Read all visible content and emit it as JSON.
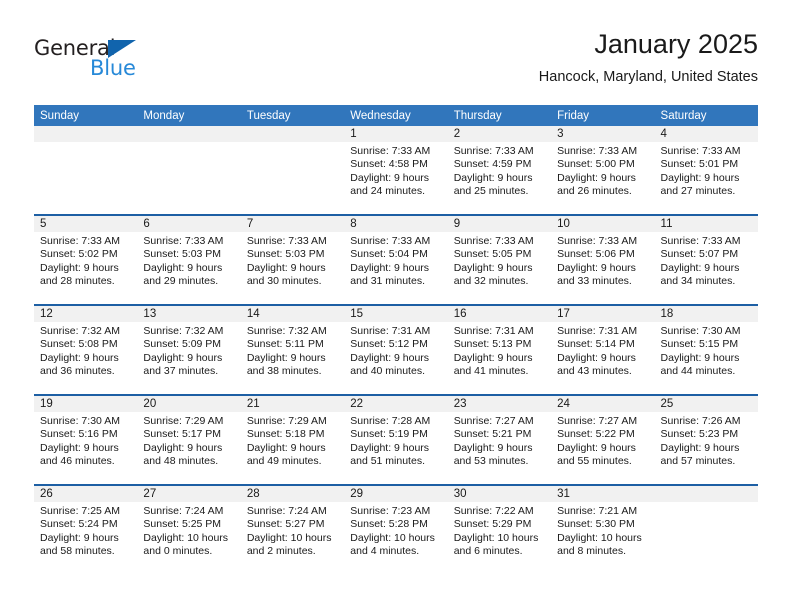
{
  "brand": {
    "name_part1": "General",
    "name_part2": "Blue",
    "color_dark": "#231f20",
    "color_blue": "#2789d8",
    "triangle_color": "#1164ad"
  },
  "header": {
    "title": "January 2025",
    "subtitle": "Hancock, Maryland, United States"
  },
  "theme": {
    "header_bar": "#3176bc",
    "row_divider": "#1d5fa4",
    "day_band": "#f1f1f1"
  },
  "weekdays": [
    "Sunday",
    "Monday",
    "Tuesday",
    "Wednesday",
    "Thursday",
    "Friday",
    "Saturday"
  ],
  "weeks": [
    [
      {
        "day": "",
        "sunrise": "",
        "sunset": "",
        "daylight1": "",
        "daylight2": ""
      },
      {
        "day": "",
        "sunrise": "",
        "sunset": "",
        "daylight1": "",
        "daylight2": ""
      },
      {
        "day": "",
        "sunrise": "",
        "sunset": "",
        "daylight1": "",
        "daylight2": ""
      },
      {
        "day": "1",
        "sunrise": "Sunrise: 7:33 AM",
        "sunset": "Sunset: 4:58 PM",
        "daylight1": "Daylight: 9 hours",
        "daylight2": "and 24 minutes."
      },
      {
        "day": "2",
        "sunrise": "Sunrise: 7:33 AM",
        "sunset": "Sunset: 4:59 PM",
        "daylight1": "Daylight: 9 hours",
        "daylight2": "and 25 minutes."
      },
      {
        "day": "3",
        "sunrise": "Sunrise: 7:33 AM",
        "sunset": "Sunset: 5:00 PM",
        "daylight1": "Daylight: 9 hours",
        "daylight2": "and 26 minutes."
      },
      {
        "day": "4",
        "sunrise": "Sunrise: 7:33 AM",
        "sunset": "Sunset: 5:01 PM",
        "daylight1": "Daylight: 9 hours",
        "daylight2": "and 27 minutes."
      }
    ],
    [
      {
        "day": "5",
        "sunrise": "Sunrise: 7:33 AM",
        "sunset": "Sunset: 5:02 PM",
        "daylight1": "Daylight: 9 hours",
        "daylight2": "and 28 minutes."
      },
      {
        "day": "6",
        "sunrise": "Sunrise: 7:33 AM",
        "sunset": "Sunset: 5:03 PM",
        "daylight1": "Daylight: 9 hours",
        "daylight2": "and 29 minutes."
      },
      {
        "day": "7",
        "sunrise": "Sunrise: 7:33 AM",
        "sunset": "Sunset: 5:03 PM",
        "daylight1": "Daylight: 9 hours",
        "daylight2": "and 30 minutes."
      },
      {
        "day": "8",
        "sunrise": "Sunrise: 7:33 AM",
        "sunset": "Sunset: 5:04 PM",
        "daylight1": "Daylight: 9 hours",
        "daylight2": "and 31 minutes."
      },
      {
        "day": "9",
        "sunrise": "Sunrise: 7:33 AM",
        "sunset": "Sunset: 5:05 PM",
        "daylight1": "Daylight: 9 hours",
        "daylight2": "and 32 minutes."
      },
      {
        "day": "10",
        "sunrise": "Sunrise: 7:33 AM",
        "sunset": "Sunset: 5:06 PM",
        "daylight1": "Daylight: 9 hours",
        "daylight2": "and 33 minutes."
      },
      {
        "day": "11",
        "sunrise": "Sunrise: 7:33 AM",
        "sunset": "Sunset: 5:07 PM",
        "daylight1": "Daylight: 9 hours",
        "daylight2": "and 34 minutes."
      }
    ],
    [
      {
        "day": "12",
        "sunrise": "Sunrise: 7:32 AM",
        "sunset": "Sunset: 5:08 PM",
        "daylight1": "Daylight: 9 hours",
        "daylight2": "and 36 minutes."
      },
      {
        "day": "13",
        "sunrise": "Sunrise: 7:32 AM",
        "sunset": "Sunset: 5:09 PM",
        "daylight1": "Daylight: 9 hours",
        "daylight2": "and 37 minutes."
      },
      {
        "day": "14",
        "sunrise": "Sunrise: 7:32 AM",
        "sunset": "Sunset: 5:11 PM",
        "daylight1": "Daylight: 9 hours",
        "daylight2": "and 38 minutes."
      },
      {
        "day": "15",
        "sunrise": "Sunrise: 7:31 AM",
        "sunset": "Sunset: 5:12 PM",
        "daylight1": "Daylight: 9 hours",
        "daylight2": "and 40 minutes."
      },
      {
        "day": "16",
        "sunrise": "Sunrise: 7:31 AM",
        "sunset": "Sunset: 5:13 PM",
        "daylight1": "Daylight: 9 hours",
        "daylight2": "and 41 minutes."
      },
      {
        "day": "17",
        "sunrise": "Sunrise: 7:31 AM",
        "sunset": "Sunset: 5:14 PM",
        "daylight1": "Daylight: 9 hours",
        "daylight2": "and 43 minutes."
      },
      {
        "day": "18",
        "sunrise": "Sunrise: 7:30 AM",
        "sunset": "Sunset: 5:15 PM",
        "daylight1": "Daylight: 9 hours",
        "daylight2": "and 44 minutes."
      }
    ],
    [
      {
        "day": "19",
        "sunrise": "Sunrise: 7:30 AM",
        "sunset": "Sunset: 5:16 PM",
        "daylight1": "Daylight: 9 hours",
        "daylight2": "and 46 minutes."
      },
      {
        "day": "20",
        "sunrise": "Sunrise: 7:29 AM",
        "sunset": "Sunset: 5:17 PM",
        "daylight1": "Daylight: 9 hours",
        "daylight2": "and 48 minutes."
      },
      {
        "day": "21",
        "sunrise": "Sunrise: 7:29 AM",
        "sunset": "Sunset: 5:18 PM",
        "daylight1": "Daylight: 9 hours",
        "daylight2": "and 49 minutes."
      },
      {
        "day": "22",
        "sunrise": "Sunrise: 7:28 AM",
        "sunset": "Sunset: 5:19 PM",
        "daylight1": "Daylight: 9 hours",
        "daylight2": "and 51 minutes."
      },
      {
        "day": "23",
        "sunrise": "Sunrise: 7:27 AM",
        "sunset": "Sunset: 5:21 PM",
        "daylight1": "Daylight: 9 hours",
        "daylight2": "and 53 minutes."
      },
      {
        "day": "24",
        "sunrise": "Sunrise: 7:27 AM",
        "sunset": "Sunset: 5:22 PM",
        "daylight1": "Daylight: 9 hours",
        "daylight2": "and 55 minutes."
      },
      {
        "day": "25",
        "sunrise": "Sunrise: 7:26 AM",
        "sunset": "Sunset: 5:23 PM",
        "daylight1": "Daylight: 9 hours",
        "daylight2": "and 57 minutes."
      }
    ],
    [
      {
        "day": "26",
        "sunrise": "Sunrise: 7:25 AM",
        "sunset": "Sunset: 5:24 PM",
        "daylight1": "Daylight: 9 hours",
        "daylight2": "and 58 minutes."
      },
      {
        "day": "27",
        "sunrise": "Sunrise: 7:24 AM",
        "sunset": "Sunset: 5:25 PM",
        "daylight1": "Daylight: 10 hours",
        "daylight2": "and 0 minutes."
      },
      {
        "day": "28",
        "sunrise": "Sunrise: 7:24 AM",
        "sunset": "Sunset: 5:27 PM",
        "daylight1": "Daylight: 10 hours",
        "daylight2": "and 2 minutes."
      },
      {
        "day": "29",
        "sunrise": "Sunrise: 7:23 AM",
        "sunset": "Sunset: 5:28 PM",
        "daylight1": "Daylight: 10 hours",
        "daylight2": "and 4 minutes."
      },
      {
        "day": "30",
        "sunrise": "Sunrise: 7:22 AM",
        "sunset": "Sunset: 5:29 PM",
        "daylight1": "Daylight: 10 hours",
        "daylight2": "and 6 minutes."
      },
      {
        "day": "31",
        "sunrise": "Sunrise: 7:21 AM",
        "sunset": "Sunset: 5:30 PM",
        "daylight1": "Daylight: 10 hours",
        "daylight2": "and 8 minutes."
      },
      {
        "day": "",
        "sunrise": "",
        "sunset": "",
        "daylight1": "",
        "daylight2": ""
      }
    ]
  ]
}
